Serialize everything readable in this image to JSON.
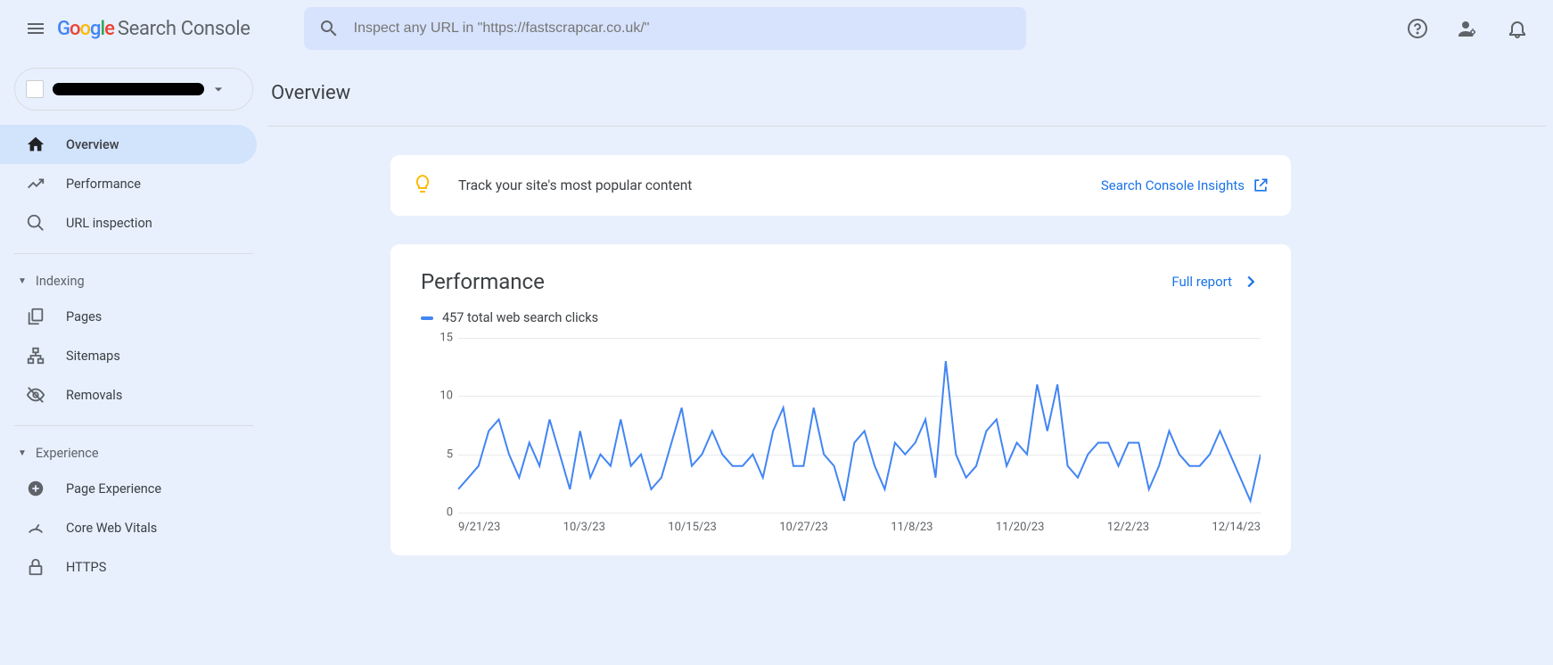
{
  "header": {
    "product_name": "Search Console",
    "search_placeholder": "Inspect any URL in \"https://fastscrapcar.co.uk/\""
  },
  "sidebar": {
    "overview": "Overview",
    "performance": "Performance",
    "url_inspection": "URL inspection",
    "section_indexing": "Indexing",
    "pages": "Pages",
    "sitemaps": "Sitemaps",
    "removals": "Removals",
    "section_experience": "Experience",
    "page_experience": "Page Experience",
    "core_web_vitals": "Core Web Vitals",
    "https": "HTTPS"
  },
  "main": {
    "page_title": "Overview",
    "insights_text": "Track your site's most popular content",
    "insights_link": "Search Console Insights",
    "performance_title": "Performance",
    "full_report": "Full report",
    "legend_text": "457 total web search clicks"
  },
  "chart_data": {
    "type": "line",
    "title": "Performance",
    "ylabel": "",
    "xlabel": "",
    "ylim": [
      0,
      15
    ],
    "yticks": [
      0,
      5,
      10,
      15
    ],
    "x_categories": [
      "9/21/23",
      "10/3/23",
      "10/15/23",
      "10/27/23",
      "11/8/23",
      "11/20/23",
      "12/2/23",
      "12/14/23"
    ],
    "series": [
      {
        "name": "total web search clicks",
        "color": "#4285f4",
        "values": [
          2,
          3,
          4,
          7,
          8,
          5,
          3,
          6,
          4,
          8,
          5,
          2,
          7,
          3,
          5,
          4,
          8,
          4,
          5,
          2,
          3,
          6,
          9,
          4,
          5,
          7,
          5,
          4,
          4,
          5,
          3,
          7,
          9,
          4,
          4,
          9,
          5,
          4,
          1,
          6,
          7,
          4,
          2,
          6,
          5,
          6,
          8,
          3,
          13,
          5,
          3,
          4,
          7,
          8,
          4,
          6,
          5,
          11,
          7,
          11,
          4,
          3,
          5,
          6,
          6,
          4,
          6,
          6,
          2,
          4,
          7,
          5,
          4,
          4,
          5,
          7,
          5,
          3,
          1,
          5
        ]
      }
    ]
  }
}
